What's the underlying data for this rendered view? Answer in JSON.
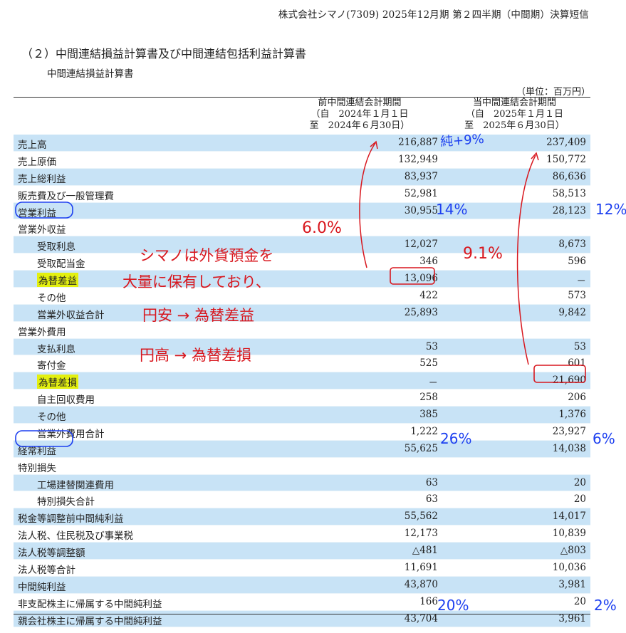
{
  "header": "株式会社シマノ(7309) 2025年12月期 第２四半期（中間期）決算短信",
  "section_title": "（２）中間連結損益計算書及び中間連結包括利益計算書",
  "subsection_title": "中間連結損益計算書",
  "unit": "（単位：百万円）",
  "columns": {
    "prev": [
      "前中間連結会計期間",
      "（自　2024年１月１日",
      "至　2024年６月30日）"
    ],
    "curr": [
      "当中間連結会計期間",
      "（自　2025年１月１日",
      "至　2025年６月30日）"
    ]
  },
  "rows": [
    {
      "label": "売上高",
      "prev": "216,887",
      "curr": "237,409",
      "indent": 0,
      "shade": true
    },
    {
      "label": "売上原価",
      "prev": "132,949",
      "curr": "150,772",
      "indent": 0,
      "shade": false
    },
    {
      "label": "売上総利益",
      "prev": "83,937",
      "curr": "86,636",
      "indent": 0,
      "shade": true
    },
    {
      "label": "販売費及び一般管理費",
      "prev": "52,981",
      "curr": "58,513",
      "indent": 0,
      "shade": false
    },
    {
      "label": "営業利益",
      "prev": "30,955",
      "curr": "28,123",
      "indent": 0,
      "shade": true
    },
    {
      "label": "営業外収益",
      "prev": "",
      "curr": "",
      "indent": 0,
      "shade": false
    },
    {
      "label": "受取利息",
      "prev": "12,027",
      "curr": "8,673",
      "indent": 1,
      "shade": true
    },
    {
      "label": "受取配当金",
      "prev": "346",
      "curr": "596",
      "indent": 1,
      "shade": false
    },
    {
      "label": "為替差益",
      "prev": "13,096",
      "curr": "－",
      "indent": 1,
      "shade": true,
      "highlight": true
    },
    {
      "label": "その他",
      "prev": "422",
      "curr": "573",
      "indent": 1,
      "shade": false
    },
    {
      "label": "営業外収益合計",
      "prev": "25,893",
      "curr": "9,842",
      "indent": 1,
      "shade": true
    },
    {
      "label": "営業外費用",
      "prev": "",
      "curr": "",
      "indent": 0,
      "shade": false
    },
    {
      "label": "支払利息",
      "prev": "53",
      "curr": "53",
      "indent": 1,
      "shade": true
    },
    {
      "label": "寄付金",
      "prev": "525",
      "curr": "601",
      "indent": 1,
      "shade": false
    },
    {
      "label": "為替差損",
      "prev": "－",
      "curr": "21,690",
      "indent": 1,
      "shade": true,
      "highlight": true
    },
    {
      "label": "自主回収費用",
      "prev": "258",
      "curr": "206",
      "indent": 1,
      "shade": false
    },
    {
      "label": "その他",
      "prev": "385",
      "curr": "1,376",
      "indent": 1,
      "shade": true
    },
    {
      "label": "営業外費用合計",
      "prev": "1,222",
      "curr": "23,927",
      "indent": 1,
      "shade": false
    },
    {
      "label": "経常利益",
      "prev": "55,625",
      "curr": "14,038",
      "indent": 0,
      "shade": true
    },
    {
      "label": "特別損失",
      "prev": "",
      "curr": "",
      "indent": 0,
      "shade": false
    },
    {
      "label": "工場建替関連費用",
      "prev": "63",
      "curr": "20",
      "indent": 1,
      "shade": true
    },
    {
      "label": "特別損失合計",
      "prev": "63",
      "curr": "20",
      "indent": 1,
      "shade": false
    },
    {
      "label": "税金等調整前中間純利益",
      "prev": "55,562",
      "curr": "14,017",
      "indent": 0,
      "shade": true
    },
    {
      "label": "法人税、住民税及び事業税",
      "prev": "12,173",
      "curr": "10,839",
      "indent": 0,
      "shade": false
    },
    {
      "label": "法人税等調整額",
      "prev": "△481",
      "curr": "△803",
      "indent": 0,
      "shade": true
    },
    {
      "label": "法人税等合計",
      "prev": "11,691",
      "curr": "10,036",
      "indent": 0,
      "shade": false
    },
    {
      "label": "中間純利益",
      "prev": "43,870",
      "curr": "3,981",
      "indent": 0,
      "shade": true
    },
    {
      "label": "非支配株主に帰属する中間純利益",
      "prev": "166",
      "curr": "20",
      "indent": 0,
      "shade": false
    },
    {
      "label": "親会社株主に帰属する中間純利益",
      "prev": "43,704",
      "curr": "3,961",
      "indent": 0,
      "shade": true
    }
  ],
  "annotations": {
    "growth": "純+9%",
    "op_margin_prev": "14%",
    "op_margin_curr": "12%",
    "fx_ratio_prev": "6.0%",
    "fx_ratio_curr": "9.1%",
    "note_lines": [
      "シマノは外貨預金を",
      "大量に保有しており、",
      "円安 → 為替差益",
      "円高 → 為替差損"
    ],
    "ord_margin_prev": "26%",
    "ord_margin_curr": "6%",
    "net_margin_prev": "20%",
    "net_margin_curr": "2%",
    "colors": {
      "red": "#d8171e",
      "blue": "#1c3ff0",
      "highlight": "#e3f010",
      "row_shade": "#c8e3f6"
    }
  }
}
